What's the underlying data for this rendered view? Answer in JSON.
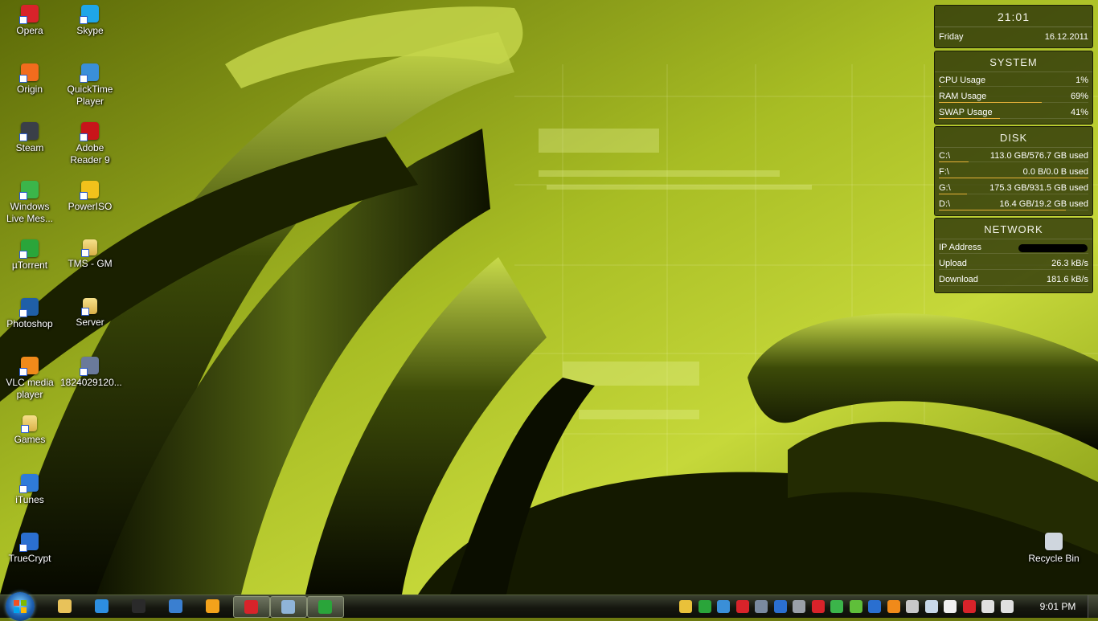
{
  "desktop": {
    "icons": [
      {
        "label": "Opera",
        "icon": "opera-icon",
        "color": "#d8232a"
      },
      {
        "label": "Skype",
        "icon": "skype-icon",
        "color": "#1fa6e8"
      },
      {
        "label": "Origin",
        "icon": "origin-icon",
        "color": "#f26c1d"
      },
      {
        "label": "QuickTime Player",
        "icon": "quicktime-icon",
        "color": "#3a8fd8"
      },
      {
        "label": "Steam",
        "icon": "steam-icon",
        "color": "#3a3f48"
      },
      {
        "label": "Adobe Reader 9",
        "icon": "adobe-reader-icon",
        "color": "#c8141a"
      },
      {
        "label": "Windows Live Mes...",
        "icon": "messenger-icon",
        "color": "#3bb54a"
      },
      {
        "label": "PowerISO",
        "icon": "poweriso-icon",
        "color": "#f2c21b"
      },
      {
        "label": "µTorrent",
        "icon": "utorrent-icon",
        "color": "#2aa53a"
      },
      {
        "label": "TMS - GM",
        "icon": "folder-icon",
        "color": "#e7c35e"
      },
      {
        "label": "Photoshop",
        "icon": "photoshop-icon",
        "color": "#1f5fa8"
      },
      {
        "label": "Server",
        "icon": "folder-icon",
        "color": "#e7c35e"
      },
      {
        "label": "VLC media player",
        "icon": "vlc-icon",
        "color": "#f08a1a"
      },
      {
        "label": "1824029120...",
        "icon": "image-file-icon",
        "color": "#6a7a9a"
      },
      {
        "label": "Games",
        "icon": "folder-icon",
        "color": "#e7c35e"
      },
      {
        "label": "iTunes",
        "icon": "itunes-icon",
        "color": "#2f7bd8"
      },
      {
        "label": "TrueCrypt",
        "icon": "truecrypt-icon",
        "color": "#2b6fd0"
      },
      {
        "label": "Recycle Bin",
        "icon": "recycle-bin-icon",
        "color": "#cfd6de"
      }
    ]
  },
  "widgets": {
    "clock": {
      "time": "21:01",
      "day": "Friday",
      "date": "16.12.2011"
    },
    "system": {
      "title": "SYSTEM",
      "rows": [
        {
          "label": "CPU Usage",
          "value": "1%",
          "percent": 1
        },
        {
          "label": "RAM Usage",
          "value": "69%",
          "percent": 69
        },
        {
          "label": "SWAP Usage",
          "value": "41%",
          "percent": 41
        }
      ]
    },
    "disk": {
      "title": "DISK",
      "rows": [
        {
          "label": "C:\\",
          "value": "113.0 GB/576.7 GB used",
          "percent": 20
        },
        {
          "label": "F:\\",
          "value": "0.0 B/0.0 B used",
          "percent": 100
        },
        {
          "label": "G:\\",
          "value": "175.3 GB/931.5 GB used",
          "percent": 19
        },
        {
          "label": "D:\\",
          "value": "16.4 GB/19.2 GB used",
          "percent": 85
        }
      ]
    },
    "network": {
      "title": "NETWORK",
      "rows": [
        {
          "label": "IP Address",
          "value": ""
        },
        {
          "label": "Upload",
          "value": "26.3 kB/s"
        },
        {
          "label": "Download",
          "value": "181.6 kB/s"
        }
      ]
    }
  },
  "taskbar": {
    "pinned": [
      {
        "icon": "explorer-icon",
        "color": "#e8c25a",
        "active": false
      },
      {
        "icon": "internet-explorer-icon",
        "color": "#2d8ee0",
        "active": false
      },
      {
        "icon": "hp-icon",
        "color": "#2a2a2a",
        "active": false
      },
      {
        "icon": "mail-icon",
        "color": "#3a7fd0",
        "active": false
      },
      {
        "icon": "media-player-icon",
        "color": "#f3a21b",
        "active": false
      },
      {
        "icon": "opera-icon",
        "color": "#d8232a",
        "active": true
      },
      {
        "icon": "network-share-icon",
        "color": "#8fb4d8",
        "active": true
      },
      {
        "icon": "utorrent-icon",
        "color": "#2aa53a",
        "active": true
      }
    ],
    "tray": [
      {
        "icon": "disc-icon",
        "color": "#e9c13a"
      },
      {
        "icon": "utorrent-tray-icon",
        "color": "#2aa53a"
      },
      {
        "icon": "monitor-tray-icon",
        "color": "#3a8fd8"
      },
      {
        "icon": "opera-tray-icon",
        "color": "#d8232a"
      },
      {
        "icon": "app-tray-icon",
        "color": "#7a8aa0"
      },
      {
        "icon": "bluetooth-icon",
        "color": "#2b6fd0"
      },
      {
        "icon": "display-tray-icon",
        "color": "#9aa0a8"
      },
      {
        "icon": "ati-icon",
        "color": "#d8232a"
      },
      {
        "icon": "wireless-icon",
        "color": "#3bb54a"
      },
      {
        "icon": "security-icon",
        "color": "#5fbf3a"
      },
      {
        "icon": "hp-tray-icon",
        "color": "#2a6fd0"
      },
      {
        "icon": "headset-icon",
        "color": "#f08a1a"
      },
      {
        "icon": "steam-tray-icon",
        "color": "#c8c8c8"
      },
      {
        "icon": "drop-icon",
        "color": "#c8d8e8"
      },
      {
        "icon": "flag-icon",
        "color": "#f0f0f0"
      },
      {
        "icon": "power-icon",
        "color": "#d8232a"
      },
      {
        "icon": "signal-icon",
        "color": "#e0e0e0"
      },
      {
        "icon": "volume-icon",
        "color": "#e0e0e0"
      }
    ],
    "clock": "9:01 PM"
  }
}
